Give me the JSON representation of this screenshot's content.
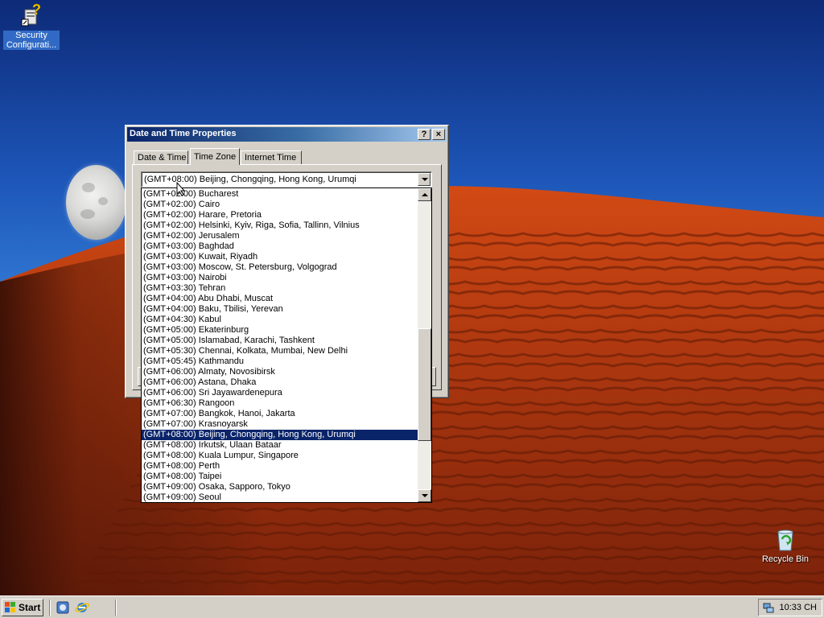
{
  "desktop": {
    "icons": [
      {
        "label": "Security Configurati...",
        "icon": "security-config-icon"
      },
      {
        "label": "Recycle Bin",
        "icon": "recycle-bin-icon"
      }
    ]
  },
  "dialog": {
    "title": "Date and Time Properties",
    "help_button": "?",
    "close_button": "×",
    "tabs": [
      {
        "label": "Date & Time",
        "active": false
      },
      {
        "label": "Time Zone",
        "active": true
      },
      {
        "label": "Internet Time",
        "active": false
      }
    ],
    "timezone": {
      "selected": "(GMT+08:00) Beijing, Chongqing, Hong Kong, Urumqi",
      "options": [
        "(GMT+02:00) Bucharest",
        "(GMT+02:00) Cairo",
        "(GMT+02:00) Harare, Pretoria",
        "(GMT+02:00) Helsinki, Kyiv, Riga, Sofia, Tallinn, Vilnius",
        "(GMT+02:00) Jerusalem",
        "(GMT+03:00) Baghdad",
        "(GMT+03:00) Kuwait, Riyadh",
        "(GMT+03:00) Moscow, St. Petersburg, Volgograd",
        "(GMT+03:00) Nairobi",
        "(GMT+03:30) Tehran",
        "(GMT+04:00) Abu Dhabi, Muscat",
        "(GMT+04:00) Baku, Tbilisi, Yerevan",
        "(GMT+04:30) Kabul",
        "(GMT+05:00) Ekaterinburg",
        "(GMT+05:00) Islamabad, Karachi, Tashkent",
        "(GMT+05:30) Chennai, Kolkata, Mumbai, New Delhi",
        "(GMT+05:45) Kathmandu",
        "(GMT+06:00) Almaty, Novosibirsk",
        "(GMT+06:00) Astana, Dhaka",
        "(GMT+06:00) Sri Jayawardenepura",
        "(GMT+06:30) Rangoon",
        "(GMT+07:00) Bangkok, Hanoi, Jakarta",
        "(GMT+07:00) Krasnoyarsk",
        "(GMT+08:00) Beijing, Chongqing, Hong Kong, Urumqi",
        "(GMT+08:00) Irkutsk, Ulaan Bataar",
        "(GMT+08:00) Kuala Lumpur, Singapore",
        "(GMT+08:00) Perth",
        "(GMT+08:00) Taipei",
        "(GMT+09:00) Osaka, Sapporo, Tokyo",
        "(GMT+09:00) Seoul"
      ],
      "selected_index": 23
    }
  },
  "taskbar": {
    "start_label": "Start",
    "clock": "10:33 CH",
    "quick_launch": [
      "server-manager-icon",
      "internet-explorer-icon"
    ]
  },
  "colors": {
    "selection": "#0a246a",
    "titlebar_start": "#0a246a",
    "titlebar_end": "#a6caf0",
    "face": "#d4d0c8"
  }
}
